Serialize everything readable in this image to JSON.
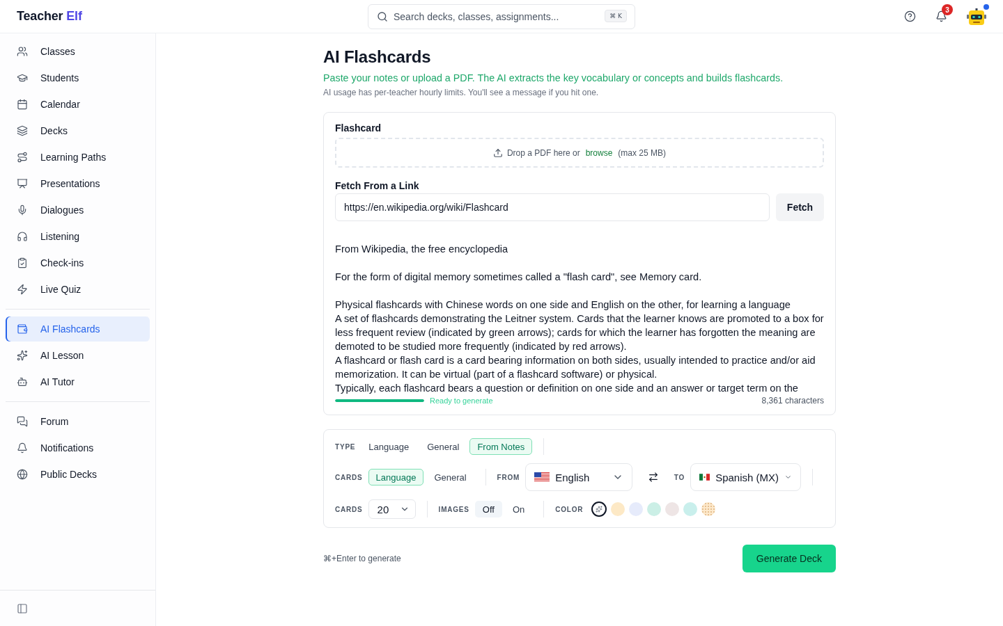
{
  "header": {
    "logo": {
      "text": "Teacher",
      "accent": "Elf"
    },
    "search": {
      "placeholder": "Search decks, classes, assignments...",
      "shortcut": "⌘ K"
    },
    "notification_badge": "3"
  },
  "sidebar": {
    "groups": [
      {
        "items": [
          {
            "label": "Classes",
            "selected": false
          },
          {
            "label": "Students",
            "selected": false
          },
          {
            "label": "Calendar",
            "selected": false
          },
          {
            "label": "Decks",
            "selected": false
          },
          {
            "label": "Learning Paths",
            "selected": false
          },
          {
            "label": "Presentations",
            "selected": false
          },
          {
            "label": "Dialogues",
            "selected": false
          },
          {
            "label": "Listening",
            "selected": false
          },
          {
            "label": "Check-ins",
            "selected": false
          },
          {
            "label": "Live Quiz",
            "selected": false
          }
        ]
      },
      {
        "items": [
          {
            "label": "AI Flashcards",
            "selected": true
          },
          {
            "label": "AI Lesson",
            "selected": false
          },
          {
            "label": "AI Tutor",
            "selected": false
          }
        ]
      },
      {
        "items": [
          {
            "label": "Forum",
            "selected": false
          },
          {
            "label": "Notifications",
            "selected": false
          },
          {
            "label": "Public Decks",
            "selected": false
          }
        ]
      }
    ]
  },
  "page": {
    "title": "AI Flashcards",
    "subtitle": "Paste your notes or upload a PDF. The AI extracts the key vocabulary or concepts and builds flashcards.",
    "note": "AI usage has per-teacher hourly limits. You'll see a message if you hit one."
  },
  "source": {
    "heading": "Flashcard",
    "dropzone": {
      "text": "Drop a PDF here or",
      "link": "browse",
      "limit": "(max 25 MB)"
    },
    "link_label": "Fetch From a Link",
    "link_input": {
      "value": "https://en.wikipedia.org/wiki/Flashcard"
    },
    "fetch_button": "Fetch",
    "notes": {
      "value": "From Wikipedia, the free encyclopedia\n\nFor the form of digital memory sometimes called a \"flash card\", see Memory card.\n\nPhysical flashcards with Chinese words on one side and English on the other, for learning a language\nA set of flashcards demonstrating the Leitner system. Cards that the learner knows are promoted to a box for less frequent review (indicated by green arrows); cards for which the learner has forgotten the meaning are demoted to be studied more frequently (indicated by red arrows).\nA flashcard or flash card is a card bearing information on both sides, usually intended to practice and/or aid memorization. It can be virtual (part of a flashcard software) or physical.\nTypically, each flashcard bears a question or definition on one side and an answer or target term on the"
    },
    "progress": {
      "level": 1,
      "status": "Ready to generate"
    },
    "char_count": "8,361 characters"
  },
  "options": {
    "type": {
      "label": "TYPE",
      "choices": [
        {
          "label": "Language",
          "selected": false
        },
        {
          "label": "General",
          "selected": false
        },
        {
          "label": "From Notes",
          "selected": true
        }
      ]
    },
    "card_style": {
      "label": "CARDS",
      "choices": [
        {
          "label": "Language",
          "selected": true
        },
        {
          "label": "General",
          "selected": false
        }
      ]
    },
    "from": {
      "label": "FROM",
      "value": "English"
    },
    "to": {
      "label": "TO",
      "value": "Spanish (MX)"
    },
    "card_count": {
      "label": "CARDS",
      "value": "20"
    },
    "images": {
      "label": "IMAGES",
      "choices": [
        {
          "label": "Off",
          "selected": true
        },
        {
          "label": "On",
          "selected": false
        }
      ]
    },
    "color": {
      "label": "COLOR",
      "swatches": [
        {
          "kind": "auto",
          "selected": true
        },
        {
          "kind": "solid",
          "color": "#fde9c6",
          "selected": false
        },
        {
          "kind": "solid",
          "color": "#e6ebfb",
          "selected": false
        },
        {
          "kind": "solid",
          "color": "#cbefe6",
          "selected": false
        },
        {
          "kind": "solid",
          "color": "#eee5e5",
          "selected": false
        },
        {
          "kind": "solid",
          "color": "#c9efec",
          "selected": false
        },
        {
          "kind": "pattern",
          "color": "#fde9cc",
          "selected": false
        }
      ]
    }
  },
  "footer": {
    "hint": "⌘+Enter to generate",
    "button": "Generate Deck"
  }
}
